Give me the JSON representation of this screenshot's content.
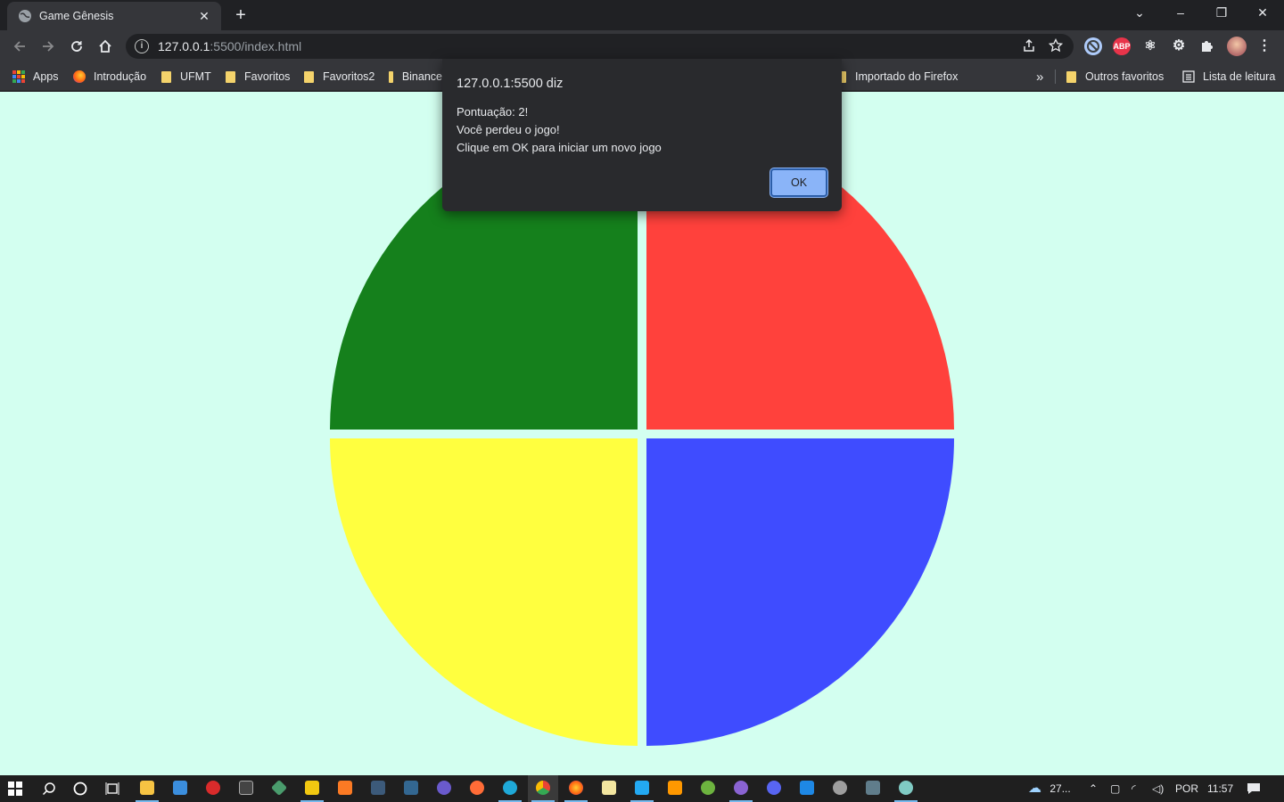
{
  "browser": {
    "tab_title": "Game Gênesis",
    "tab_close": "✕",
    "new_tab": "+",
    "window_controls": {
      "minimize": "–",
      "restore": "❐",
      "close": "✕",
      "tab_search": "⌄"
    },
    "url_host": "127.0.0.1",
    "url_path": ":5500/index.html",
    "info_glyph": "i"
  },
  "bookmarks": {
    "apps": "Apps",
    "items": [
      "Introdução",
      "UFMT",
      "Favoritos",
      "Favoritos2",
      "Binance",
      "Importado do Firefox"
    ],
    "overflow": "»",
    "other": "Outros favoritos",
    "reading_list": "Lista de leitura"
  },
  "extensions": {
    "abp": "ABP"
  },
  "game": {
    "colors": {
      "green": "#15801c",
      "red": "#ff413c",
      "yellow": "#ffff3f",
      "blue": "#3f4cff",
      "background": "#d3fff0"
    }
  },
  "dialog": {
    "title": "127.0.0.1:5500 diz",
    "line1": "Pontuação: 2!",
    "line2": "Você perdeu o jogo!",
    "line3": "Clique em OK para iniciar um novo jogo",
    "ok_label": "OK"
  },
  "taskbar": {
    "weather": "27...",
    "language": "POR",
    "time": "11:57"
  }
}
